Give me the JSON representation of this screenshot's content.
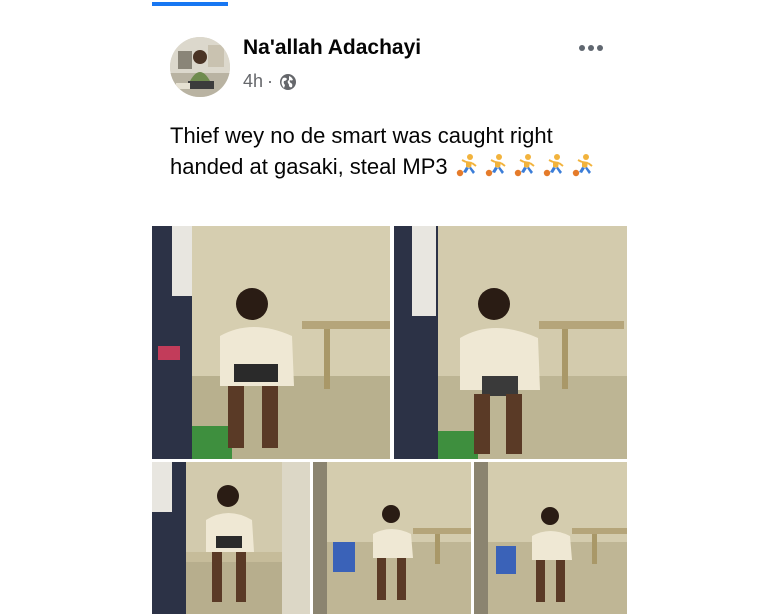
{
  "post": {
    "author": "Na'allah Adachayi",
    "time": "4h",
    "separator": "·",
    "privacy_icon": "globe-icon",
    "text": "Thief wey no de smart was caught right handed at gasaki, steal MP3",
    "emoji_icon": "person-bouncing-ball-icon",
    "emoji_count": 5,
    "photo_count": 5
  },
  "colors": {
    "accent": "#1877f2",
    "text_primary": "#050505",
    "text_secondary": "#65676b"
  }
}
